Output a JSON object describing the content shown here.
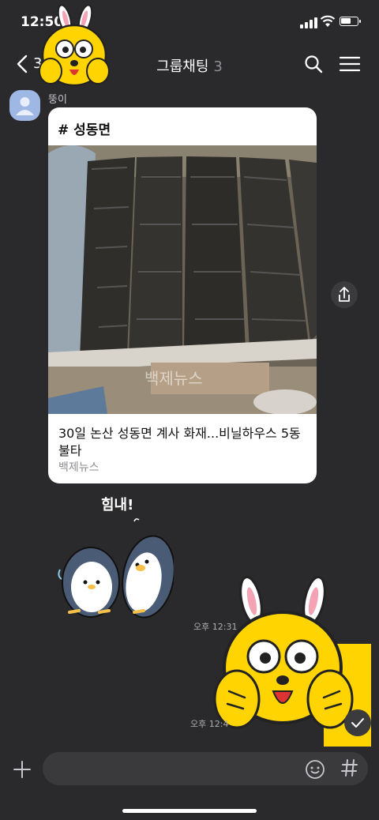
{
  "status": {
    "time": "12:50"
  },
  "header": {
    "back_count": "3",
    "title": "그룹채팅",
    "member_count": "3"
  },
  "message": {
    "sender": "뚱이",
    "card": {
      "tag": "# 성동면",
      "headline": "30일 논산 성동면 계사 화재...비닐하우스 5동 불타",
      "source": "백제뉴스",
      "watermark": "백제뉴스"
    }
  },
  "stickers": {
    "penguin_text": "힘내!"
  },
  "timestamps": {
    "first": "오후 12:31",
    "second": "오후 12:4"
  },
  "icons": [
    "chevron-left-icon",
    "search-icon",
    "menu-icon",
    "share-icon",
    "check-icon",
    "plus-icon",
    "emoji-icon",
    "hash-icon"
  ],
  "colors": {
    "background": "#2a2a2c",
    "card": "#ffffff",
    "sticker_yellow": "#ffd400"
  }
}
